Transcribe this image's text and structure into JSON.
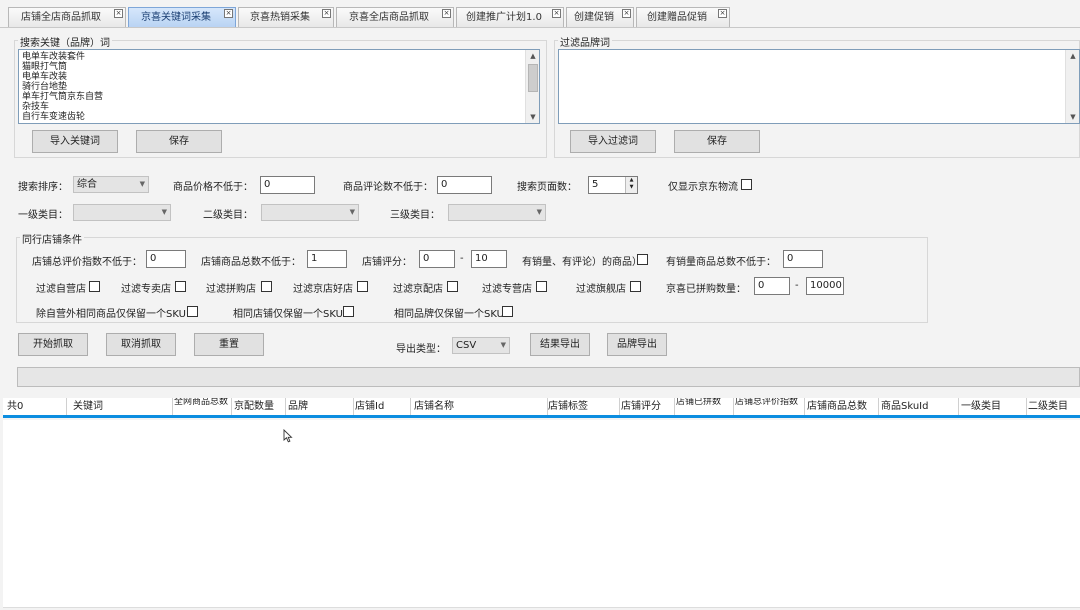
{
  "tabs": [
    {
      "label": "店铺全店商品抓取",
      "active": false
    },
    {
      "label": "京喜关键词采集",
      "active": true
    },
    {
      "label": "京喜热销采集",
      "active": false
    },
    {
      "label": "京喜全店商品抓取",
      "active": false
    },
    {
      "label": "创建推广计划1.0",
      "active": false
    },
    {
      "label": "创建促销",
      "active": false
    },
    {
      "label": "创建赠品促销",
      "active": false
    }
  ],
  "tab_close_glyph": "×",
  "keywords_group": {
    "title": "搜索关键（品牌）词",
    "items": [
      "电单车改装套件",
      "猫眼打气筒",
      "电单车改装",
      "骑行台地垫",
      "单车打气筒京东自营",
      "杂技车",
      "自行车变速齿轮"
    ],
    "import_label": "导入关键词",
    "save_label": "保存"
  },
  "filter_group": {
    "title": "过滤品牌词",
    "import_label": "导入过滤词",
    "save_label": "保存"
  },
  "search": {
    "sort_label": "搜索排序：",
    "sort_value": "综合",
    "price_label": "商品价格不低于：",
    "price_value": "0",
    "reviews_label": "商品评论数不低于：",
    "reviews_value": "0",
    "pages_label": "搜索页面数：",
    "pages_value": "5",
    "jd_logistics_label": "仅显示京东物流",
    "cat1_label": "一级类目：",
    "cat2_label": "二级类目：",
    "cat3_label": "三级类目："
  },
  "peer": {
    "title": "同行店铺条件",
    "score_index_label": "店铺总评价指数不低于：",
    "score_index_value": "0",
    "total_goods_label": "店铺商品总数不低于：",
    "total_goods_value": "1",
    "rating_label": "店铺评分：",
    "rating_min": "0",
    "rating_dash": "-",
    "rating_max": "10",
    "has_sales_label": "有销量、有评论）的商品）",
    "sales_goods_label": "有销量商品总数不低于：",
    "sales_goods_value": "0",
    "filter_self": "过滤自营店",
    "filter_exclusive": "过滤专卖店",
    "filter_pingou": "过滤拼购店",
    "filter_jd_good": "过滤京店好店",
    "filter_jd_delivery": "过滤京配店",
    "filter_specialty": "过滤专营店",
    "filter_flagship": "过滤旗舰店",
    "jx_bought_label": "京喜已拼购数量：",
    "jx_bought_min": "0",
    "jx_bought_dash": "-",
    "jx_bought_max": "10000",
    "keep_one_except_self": "除自营外相同商品仅保留一个SKU",
    "keep_one_same_shop": "相同店铺仅保留一个SKU",
    "keep_one_same_brand": "相同品牌仅保留一个SKU"
  },
  "actions": {
    "start": "开始抓取",
    "cancel": "取消抓取",
    "reset": "重置",
    "export_type_label": "导出类型：",
    "export_type_value": "CSV",
    "export_results": "结果导出",
    "export_brands": "品牌导出"
  },
  "grid": {
    "columns": [
      "共0",
      "关键词",
      "全网商品总数",
      "京配数量",
      "品牌",
      "店铺Id",
      "店铺名称",
      "店铺标签",
      "店铺评分",
      "店铺已拼数",
      "店铺总评价指数",
      "店铺商品总数",
      "商品SkuId",
      "一级类目",
      "二级类目"
    ]
  }
}
